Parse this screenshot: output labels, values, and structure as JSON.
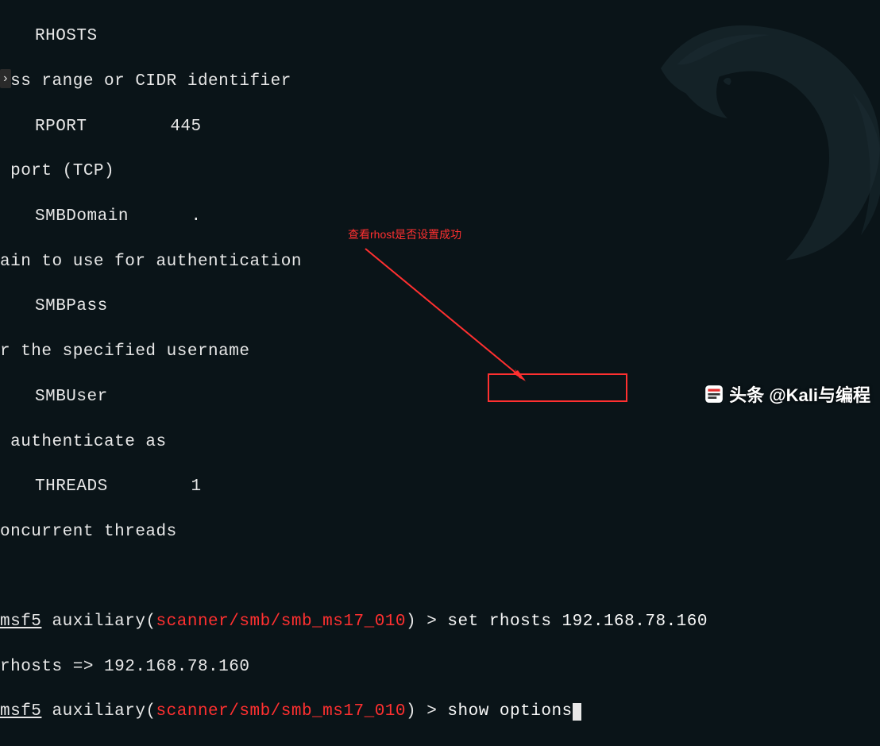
{
  "lines": {
    "l1": "RHOSTS",
    "l2": "ess range or CIDR identifier",
    "l3": "RPORT        445",
    "l4": " port (TCP)",
    "l5": "SMBDomain      .",
    "l6": "ain to use for authentication",
    "l7": "SMBPass",
    "l8": "r the specified username",
    "l9": "SMBUser",
    "l10": " authenticate as",
    "l11": "THREADS        1",
    "l12": "oncurrent threads"
  },
  "prompt1": {
    "prefix": "msf5",
    "aux": " auxiliary(",
    "module": "scanner/smb/smb_ms17_010",
    "suffix": ") > ",
    "cmd": "set rhosts 192.168.78.160"
  },
  "result": "rhosts => 192.168.78.160",
  "prompt2": {
    "prefix": "msf5",
    "aux": " auxiliary(",
    "module": "scanner/smb/smb_ms17_010",
    "suffix": ") > ",
    "cmd": "show options"
  },
  "annotation": "查看rhost是否设置成功",
  "watermark": "头条 @Kali与编程",
  "side_arrow": "›"
}
